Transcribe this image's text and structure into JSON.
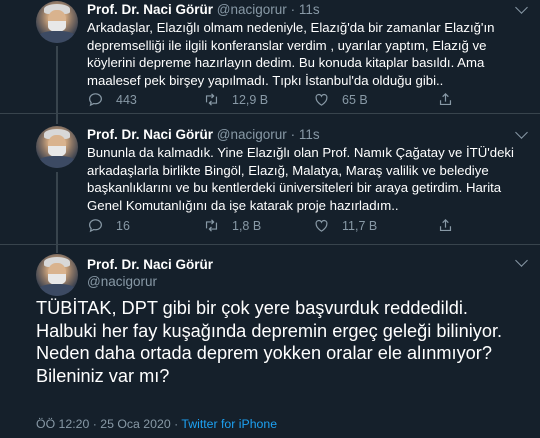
{
  "tweets": [
    {
      "name": "Prof. Dr. Naci Görür",
      "handle": "@nacigorur",
      "separator": "·",
      "time": "11s",
      "text": "Arkadaşlar, Elazığlı olmam nedeniyle, Elazığ'da bir zamanlar Elazığ'ın depremselliği ile ilgili konferanslar verdim , uyarılar yaptım, Elazığ ve köylerini depreme hazırlayın dedim. Bu konuda kitaplar basıldı. Ama maalesef pek birşey yapılmadı. Tıpkı İstanbul'da olduğu gibi..",
      "replies": "443",
      "retweets": "12,9 B",
      "likes": "65 B"
    },
    {
      "name": "Prof. Dr. Naci Görür",
      "handle": "@nacigorur",
      "separator": "·",
      "time": "11s",
      "text": "Bununla da kalmadık. Yine Elazığlı olan Prof. Namık Çağatay ve İTÜ'deki arkadaşlarla birlikte Bingöl, Elazığ, Malatya, Maraş valilik ve belediye başkanlıklarını ve bu kentlerdeki üniversiteleri bir araya getirdim. Harita Genel Komutanlığını da işe katarak proje hazırladım..",
      "replies": "16",
      "retweets": "1,8 B",
      "likes": "11,7 B"
    }
  ],
  "main_tweet": {
    "name": "Prof. Dr. Naci Görür",
    "handle": "@nacigorur",
    "text": "TÜBİTAK, DPT gibi bir çok yere başvurduk reddedildi. Halbuki her fay kuşağında depremin ergeç geleği biliniyor. Neden daha ortada deprem yokken oralar ele alınmıyor? Bileniniz var mı?",
    "timestamp": "ÖÖ 12:20 · 25 Oca 2020 · ",
    "source": "Twitter for iPhone"
  },
  "colors": {
    "background": "#15202b",
    "divider": "#38444d",
    "secondary_text": "#8899a6",
    "link": "#1da1f2"
  }
}
